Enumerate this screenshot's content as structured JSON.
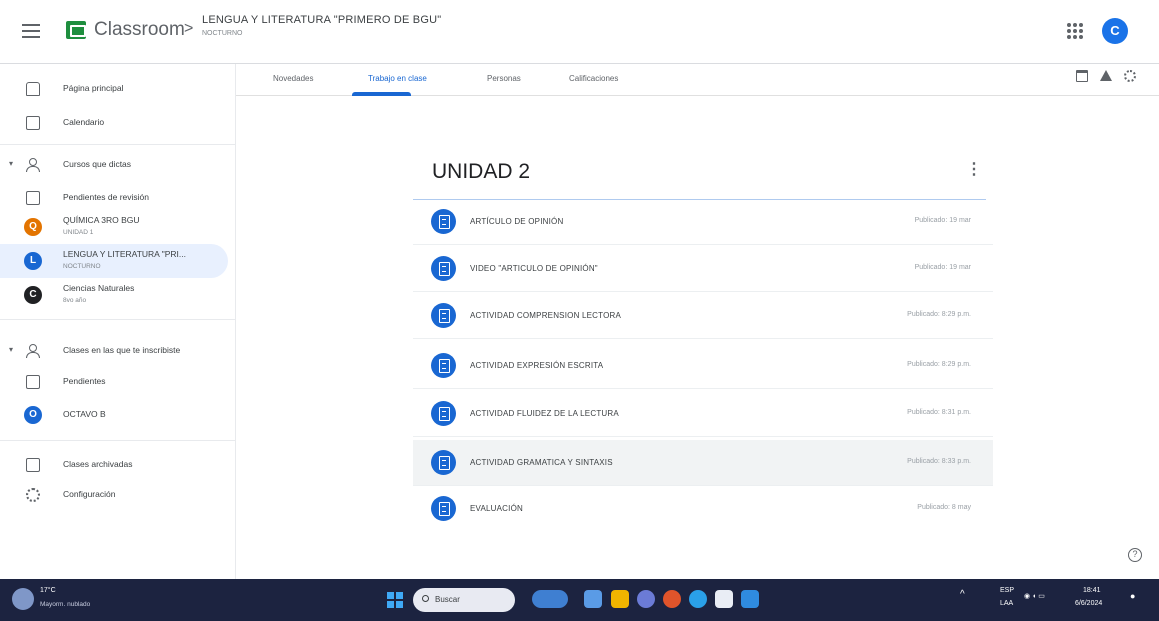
{
  "header": {
    "brand": "Classroom",
    "separator": ">",
    "course_title": "LENGUA Y LITERATURA \"PRIMERO DE BGU\"",
    "course_subtitle": "NOCTURNO",
    "account_initial": "C"
  },
  "sidebar": {
    "home": "Página principal",
    "calendar": "Calendario",
    "teaching": "Cursos que dictas",
    "to_review": "Pendientes de revisión",
    "courses": [
      {
        "initial": "Q",
        "name": "QUÍMICA 3RO BGU",
        "sub": "UNIDAD 1",
        "color": "#e37400"
      },
      {
        "initial": "L",
        "name": "LENGUA Y LITERATURA \"PRI...",
        "sub": "NOCTURNO",
        "color": "#1967d2"
      },
      {
        "initial": "C",
        "name": "Ciencias Naturales",
        "sub": "8vo año",
        "color": "#202124"
      }
    ],
    "enrolled": "Clases en las que te inscribiste",
    "todo": "Pendientes",
    "enrolled_course": {
      "initial": "O",
      "name": "OCTAVO B",
      "color": "#1967d2"
    },
    "archived": "Clases archivadas",
    "settings": "Configuración"
  },
  "tabs": {
    "items": [
      "Novedades",
      "Trabajo en clase",
      "Personas",
      "Calificaciones"
    ],
    "active": "Trabajo en clase"
  },
  "topic": {
    "title": "UNIDAD 2",
    "tasks": [
      {
        "title": "ARTÍCULO DE OPINIÓN",
        "date": "Publicado: 19 mar"
      },
      {
        "title": "VIDEO \"ARTICULO DE OPINIÓN\"",
        "date": "Publicado: 19 mar"
      },
      {
        "title": "ACTIVIDAD COMPRENSION LECTORA",
        "date": "Publicado: 8:29 p.m."
      },
      {
        "title": "ACTIVIDAD EXPRESIÓN ESCRITA",
        "date": "Publicado: 8:29 p.m."
      },
      {
        "title": "ACTIVIDAD FLUIDEZ DE LA LECTURA",
        "date": "Publicado: 8:31 p.m."
      },
      {
        "title": "ACTIVIDAD GRAMATICA Y SINTAXIS",
        "date": "Publicado: 8:33 p.m."
      },
      {
        "title": "EVALUACIÓN",
        "date": "Publicado: 8 may"
      }
    ]
  },
  "taskbar": {
    "temperature": "17°C",
    "weather": "Mayorm. nublado",
    "search_placeholder": "Buscar",
    "language": "ESP",
    "region": "LAA",
    "time": "18:41",
    "date": "6/6/2024"
  },
  "colors": {
    "accent": "#1967d2",
    "taskbar": "#1c2340"
  },
  "icons": [
    "menu-icon",
    "classroom-logo-icon",
    "apps-grid-icon",
    "calendar-icon",
    "drive-icon",
    "settings-icon",
    "home-icon",
    "people-icon",
    "inbox-icon",
    "archive-icon",
    "assignment-icon",
    "help-icon",
    "windows-icon",
    "search-icon"
  ]
}
